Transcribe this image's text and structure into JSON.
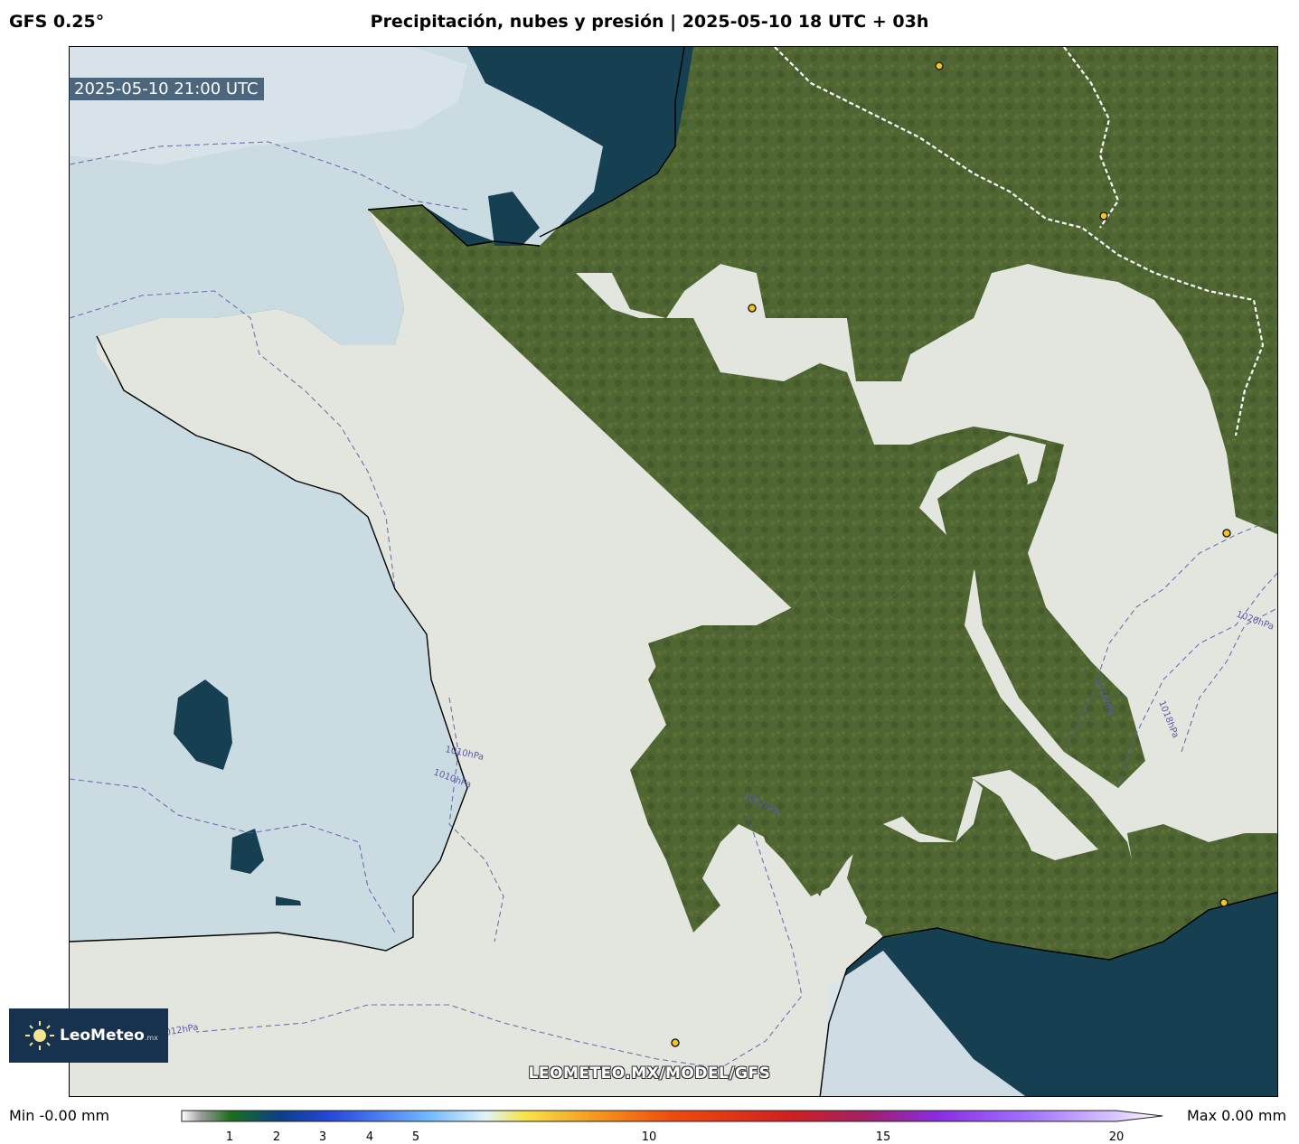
{
  "header": {
    "model": "GFS 0.25°",
    "title": "Precipitación, nubes y presión | 2025-05-10 18 UTC + 03h"
  },
  "map": {
    "valid_time": "2025-05-10 21:00 UTC",
    "watermark": "LEOMETEO.MX/MODEL/GFS",
    "isobar_labels": [
      "1010hPa",
      "1010hPa",
      "1012hPa",
      "1016hPa",
      "1018hPa",
      "1020hPa",
      "1012hPa"
    ],
    "colors": {
      "sea": "#163f52",
      "land": "#4e6330",
      "cloud_cover": "#e9ebe6",
      "sea_cloud": "#d3e1e8",
      "isobar": "#5a5aa8",
      "city_marker": "#f2c81e"
    }
  },
  "logo": {
    "name": "LeoMeteo",
    "suffix": ".mx",
    "icon": "sun-icon"
  },
  "legend": {
    "min_label": "Min -0.00 mm",
    "max_label": "Max 0.00 mm",
    "ticks": [
      "1",
      "2",
      "3",
      "4",
      "5",
      "10",
      "15",
      "20"
    ],
    "colors": [
      "#ffffff",
      "#9a9a9a",
      "#1c6e1c",
      "#0b3f86",
      "#2447d8",
      "#4a7cf0",
      "#6fb7ff",
      "#ffffff",
      "#f7e44a",
      "#f69a1c",
      "#ef4a10",
      "#d02020",
      "#a0206a",
      "#8a2be2",
      "#a070ff",
      "#d8c4ff",
      "#ffffff"
    ]
  }
}
